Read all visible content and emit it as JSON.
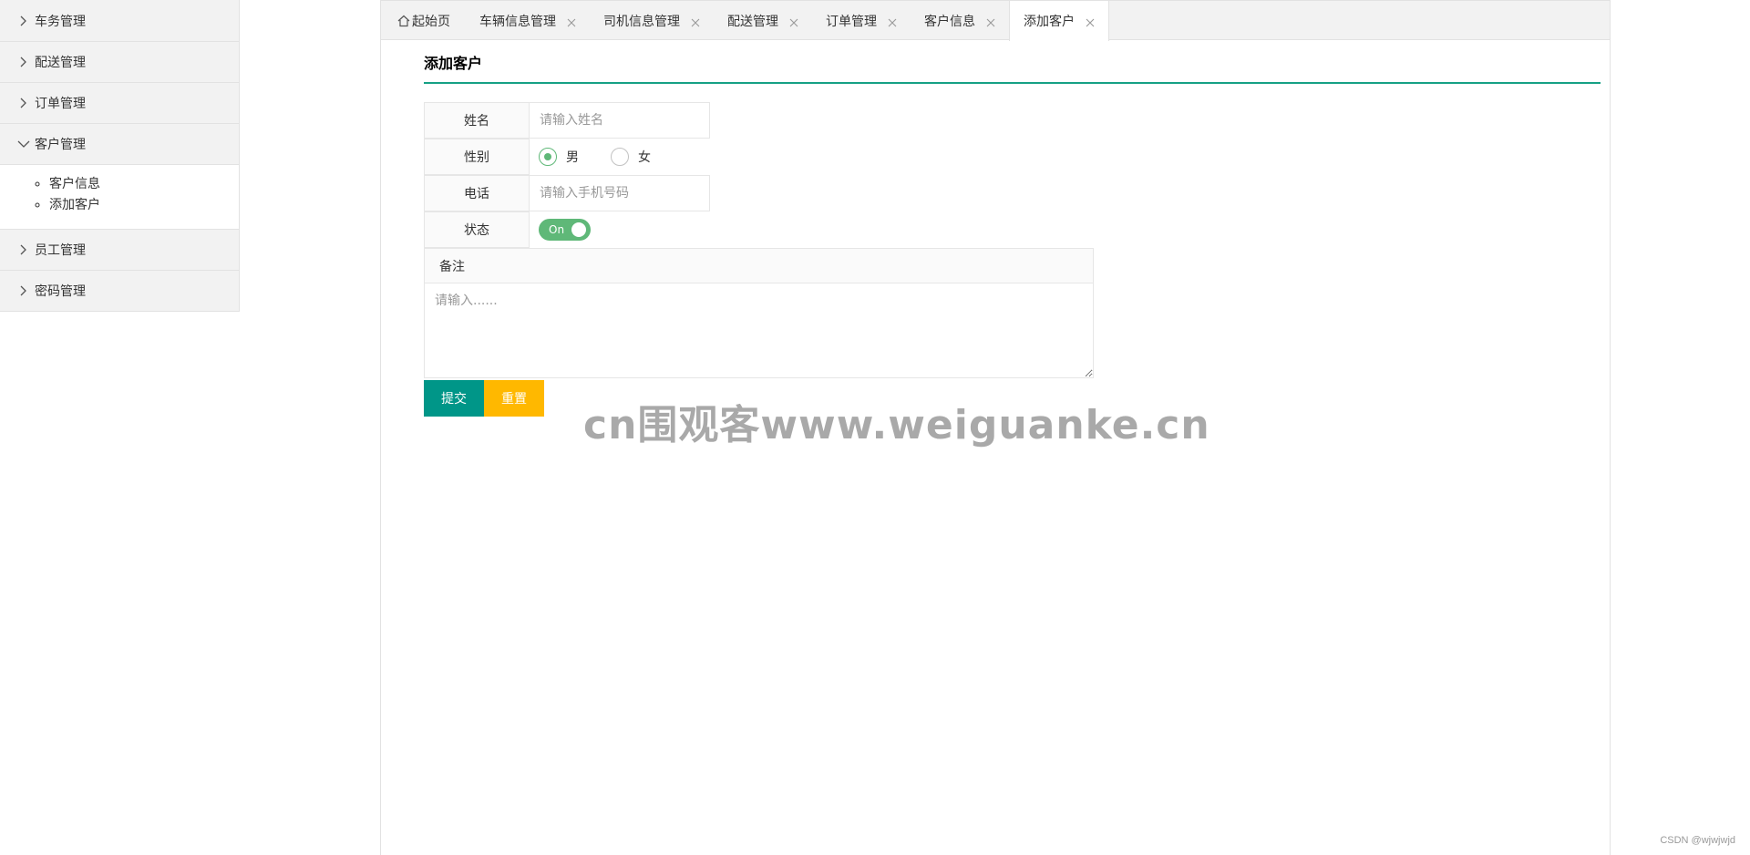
{
  "sidebar": {
    "groups": [
      {
        "label": "车务管理",
        "expanded": false
      },
      {
        "label": "配送管理",
        "expanded": false
      },
      {
        "label": "订单管理",
        "expanded": false
      },
      {
        "label": "客户管理",
        "expanded": true,
        "items": [
          "客户信息",
          "添加客户"
        ]
      },
      {
        "label": "员工管理",
        "expanded": false
      },
      {
        "label": "密码管理",
        "expanded": false
      }
    ]
  },
  "tabs": [
    {
      "label": "起始页",
      "icon": "home-icon",
      "closable": false
    },
    {
      "label": "车辆信息管理",
      "closable": true
    },
    {
      "label": "司机信息管理",
      "closable": true
    },
    {
      "label": "配送管理",
      "closable": true
    },
    {
      "label": "订单管理",
      "closable": true
    },
    {
      "label": "客户信息",
      "closable": true
    },
    {
      "label": "添加客户",
      "closable": true,
      "active": true
    }
  ],
  "form": {
    "title": "添加客户",
    "name_label": "姓名",
    "name_placeholder": "请输入姓名",
    "gender_label": "性别",
    "gender_options": [
      "男",
      "女"
    ],
    "gender_selected": "男",
    "phone_label": "电话",
    "phone_placeholder": "请输入手机号码",
    "status_label": "状态",
    "status_switch_text": "On",
    "status_on": true,
    "remark_label": "备注",
    "remark_placeholder": "请输入......",
    "submit_label": "提交",
    "reset_label": "重置"
  },
  "watermark": "cn围观客www.weiguanke.cn",
  "credit": "CSDN @wjwjwjd",
  "colors": {
    "accent": "#009688",
    "title_underline": "#16a085",
    "radio_switch": "#5fb878",
    "reset_button": "#ffb800",
    "sidebar_bg": "#f2f2f2"
  }
}
